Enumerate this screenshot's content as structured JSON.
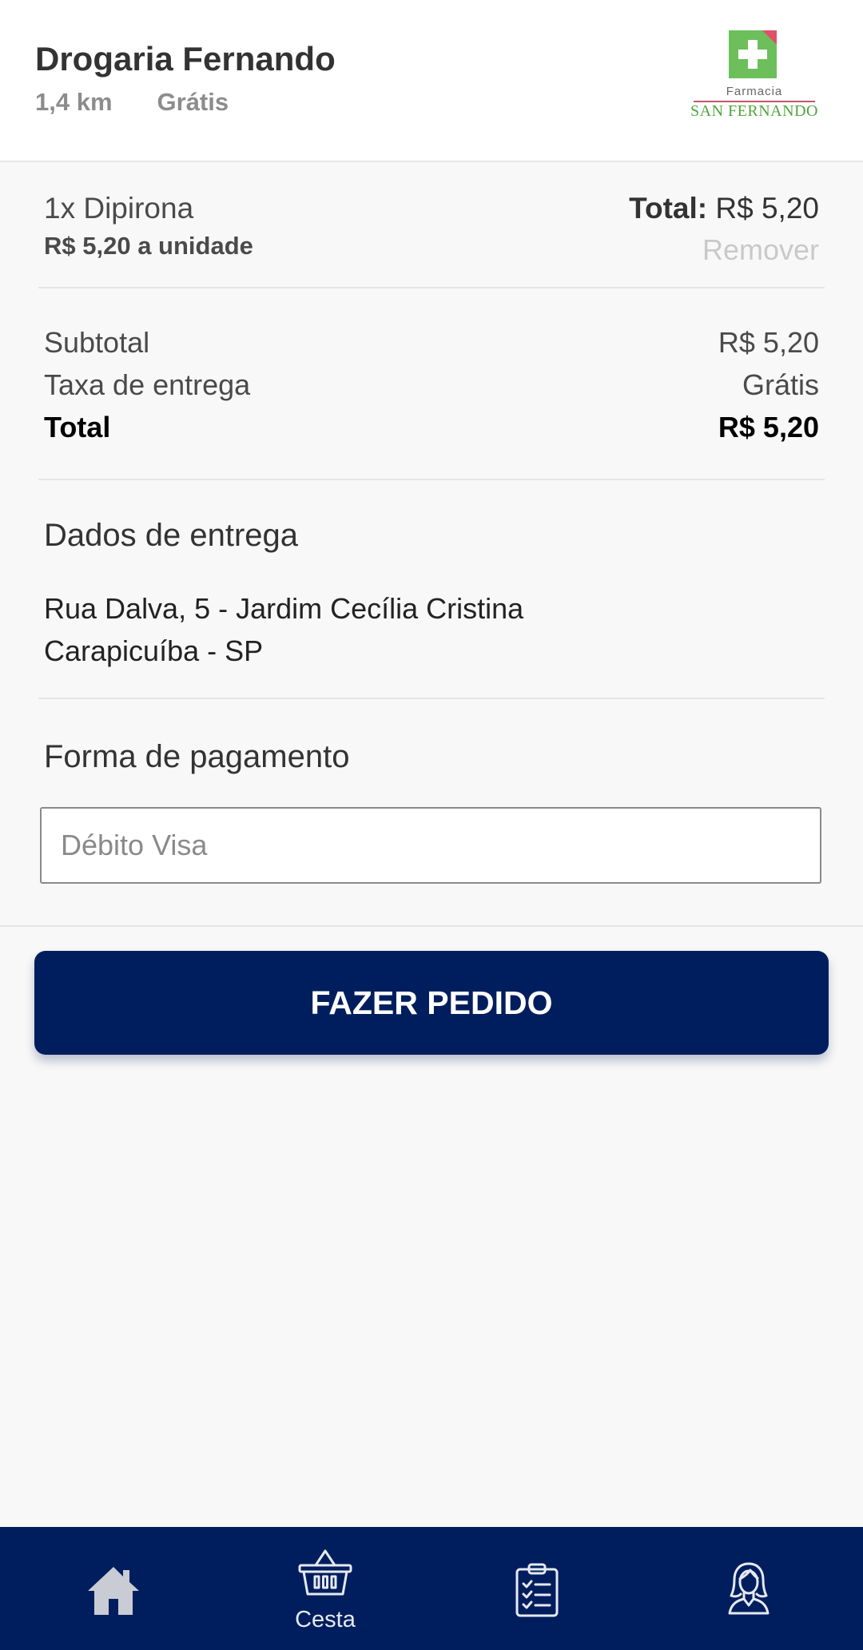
{
  "header": {
    "store_name": "Drogaria Fernando",
    "distance": "1,4 km",
    "delivery": "Grátis",
    "logo": {
      "small_text": "Farmacia",
      "big_text": "SAN FERNANDO"
    }
  },
  "cart": {
    "item_name": "1x Dipirona",
    "item_unit_price": "R$ 5,20 a unidade",
    "item_total_label": "Total:",
    "item_total_value": "R$ 5,20",
    "remove_label": "Remover"
  },
  "summary": {
    "subtotal_label": "Subtotal",
    "subtotal_value": "R$ 5,20",
    "fee_label": "Taxa de entrega",
    "fee_value": "Grátis",
    "total_label": "Total",
    "total_value": "R$ 5,20"
  },
  "delivery": {
    "title": "Dados de entrega",
    "address_line1": "Rua Dalva, 5 - Jardim Cecília Cristina",
    "address_line2": "Carapicuíba - SP"
  },
  "payment": {
    "title": "Forma de pagamento",
    "placeholder": "Débito Visa",
    "value": ""
  },
  "actions": {
    "order_button": "FAZER PEDIDO"
  },
  "bottom_nav": {
    "items": [
      {
        "icon": "home-icon",
        "label": ""
      },
      {
        "icon": "basket-icon",
        "label": "Cesta"
      },
      {
        "icon": "clipboard-icon",
        "label": ""
      },
      {
        "icon": "profile-icon",
        "label": ""
      }
    ]
  },
  "colors": {
    "primary": "#001e5d",
    "background": "#f8f8f8",
    "muted": "#8c8c8c",
    "remove": "#c9c9c9",
    "logo_green": "#6cbf5b",
    "logo_red": "#e0506a"
  }
}
